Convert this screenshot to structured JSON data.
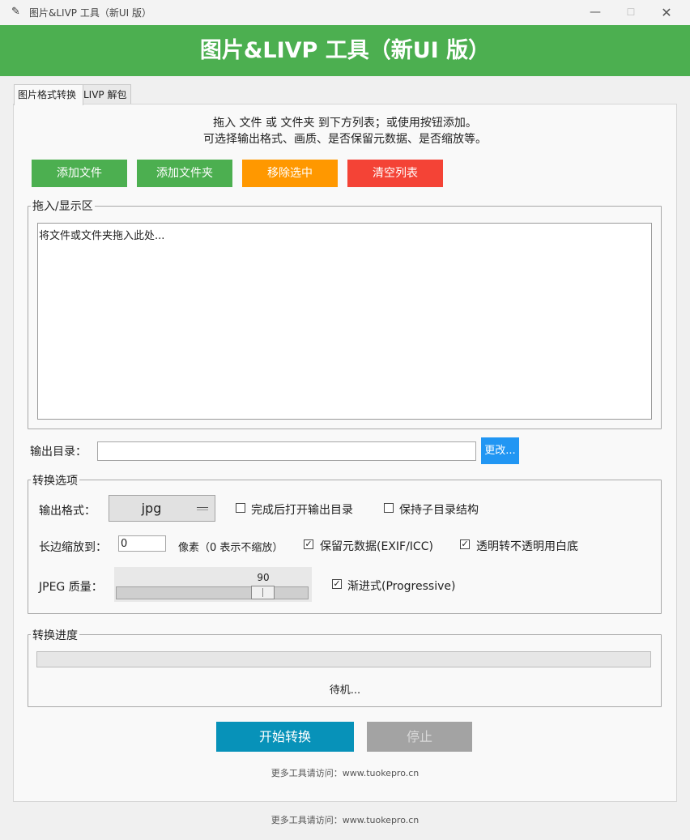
{
  "window": {
    "title": "图片&LIVP 工具（新UI 版）",
    "controls": {
      "minimize": "—",
      "maximize": "☐",
      "close": "✕"
    }
  },
  "banner": {
    "title": "图片&LIVP 工具（新UI 版）",
    "bg_color": "#4caf50"
  },
  "tabs": [
    {
      "label": "图片格式转换",
      "active": true
    },
    {
      "label": "LIVP 解包",
      "active": false
    }
  ],
  "hint": {
    "line1": "拖入 文件 或 文件夹 到下方列表；或使用按钮添加。",
    "line2": "可选择输出格式、画质、是否保留元数据、是否缩放等。"
  },
  "buttons": {
    "add_file": "添加文件",
    "add_folder": "添加文件夹",
    "remove_selected": "移除选中",
    "clear_list": "清空列表"
  },
  "drop_area": {
    "group_label": "拖入/显示区",
    "placeholder": "将文件或文件夹拖入此处..."
  },
  "output": {
    "label": "输出目录：",
    "value": "",
    "change_button": "更改..."
  },
  "options": {
    "group_label": "转换选项",
    "format_label": "输出格式：",
    "format_value": "jpg",
    "open_after": {
      "label": "完成后打开输出目录",
      "checked": false
    },
    "keep_structure": {
      "label": "保持子目录结构",
      "checked": false
    },
    "resize_label": "长边缩放到：",
    "resize_value": "0",
    "resize_unit": "像素（0 表示不缩放）",
    "keep_meta": {
      "label": "保留元数据(EXIF/ICC)",
      "checked": true
    },
    "white_bg": {
      "label": "透明转不透明用白底",
      "checked": true
    },
    "quality_label": "JPEG 质量：",
    "quality_value": "90",
    "quality_fraction": 0.8,
    "progressive": {
      "label": "渐进式(Progressive)",
      "checked": true
    }
  },
  "progress": {
    "group_label": "转换进度",
    "percent": 0,
    "status": "待机..."
  },
  "actions": {
    "start": "开始转换",
    "stop": "停止"
  },
  "footer": {
    "inner": "更多工具请访问：www.tuokepro.cn",
    "outer": "更多工具请访问：www.tuokepro.cn"
  }
}
